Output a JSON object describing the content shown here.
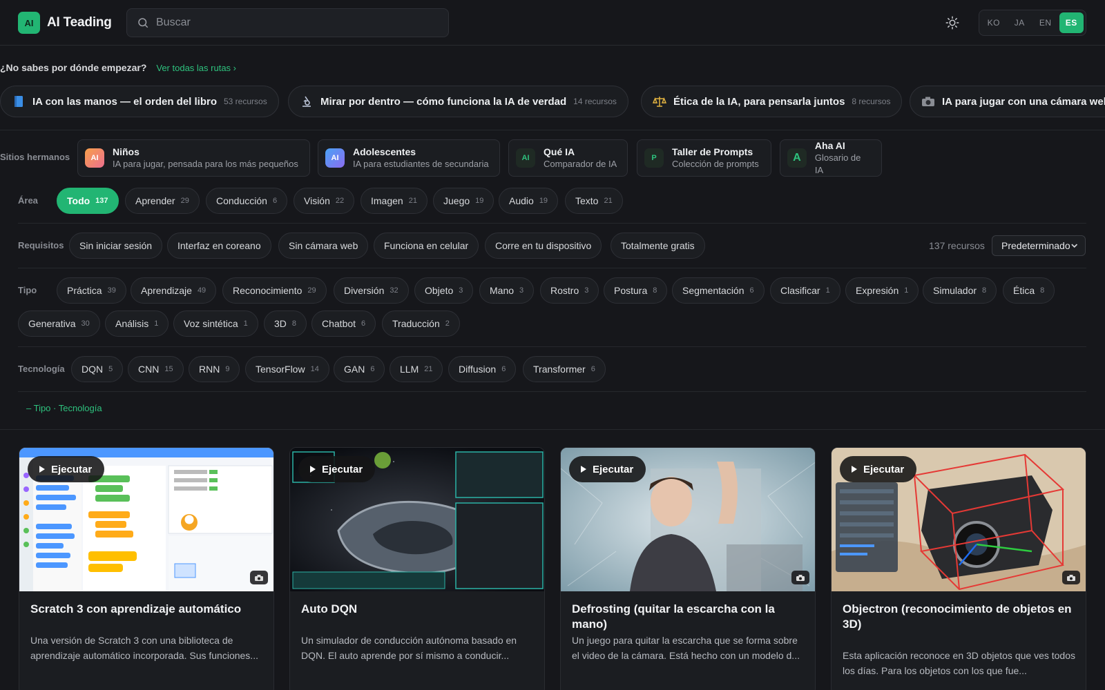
{
  "header": {
    "logo_badge": "AI",
    "brand": "AI Teading",
    "search_placeholder": "Buscar",
    "languages": [
      "KO",
      "JA",
      "EN",
      "ES"
    ],
    "active_language": "ES"
  },
  "paths": {
    "question": "¿No sabes por dónde empezar?",
    "see_all": "Ver todas las rutas ›",
    "items": [
      {
        "title": "IA con las manos — el orden del libro",
        "count": "53 recursos",
        "icon": "book-icon"
      },
      {
        "title": "Mirar por dentro — cómo funciona la IA de verdad",
        "count": "14 recursos",
        "icon": "microscope-icon"
      },
      {
        "title": "Ética de la IA, para pensarla juntos",
        "count": "8 recursos",
        "icon": "scales-icon"
      },
      {
        "title": "IA para jugar con una cámara web",
        "count": "",
        "icon": "camera-icon"
      }
    ]
  },
  "sister_sites": {
    "label": "Sitios hermanos",
    "items": [
      {
        "icon_text": "AI",
        "title": "Niños",
        "subtitle": "IA para jugar, pensada para los más pequeños",
        "color": "#f28b45"
      },
      {
        "icon_text": "AI",
        "title": "Adolescentes",
        "subtitle": "IA para estudiantes de secundaria",
        "color": "#5b8df5"
      },
      {
        "icon_text": "AI",
        "title": "Qué IA",
        "subtitle": "Comparador de IA",
        "color": "#1f2a24"
      },
      {
        "icon_text": "P",
        "title": "Taller de Prompts",
        "subtitle": "Colección de prompts",
        "color": "#1f2a24"
      },
      {
        "icon_text": "A",
        "title": "Aha AI",
        "subtitle": "Glosario de IA",
        "color": "#1f2a24"
      }
    ]
  },
  "filters": {
    "area_label": "Área",
    "area": [
      {
        "label": "Todo",
        "count": "137",
        "active": true
      },
      {
        "label": "Aprender",
        "count": "29"
      },
      {
        "label": "Conducción",
        "count": "6"
      },
      {
        "label": "Visión",
        "count": "22"
      },
      {
        "label": "Imagen",
        "count": "21"
      },
      {
        "label": "Juego",
        "count": "19"
      },
      {
        "label": "Audio",
        "count": "19"
      },
      {
        "label": "Texto",
        "count": "21"
      }
    ],
    "req_label": "Requisitos",
    "requirements": [
      "Sin iniciar sesión",
      "Interfaz en coreano",
      "Sin cámara web",
      "Funciona en celular",
      "Corre en tu dispositivo",
      "Totalmente gratis"
    ],
    "result_count": "137 recursos",
    "sort_value": "Predeterminado",
    "type_label": "Tipo",
    "types": [
      {
        "label": "Práctica",
        "count": "39"
      },
      {
        "label": "Aprendizaje",
        "count": "49"
      },
      {
        "label": "Reconocimiento",
        "count": "29"
      },
      {
        "label": "Diversión",
        "count": "32"
      },
      {
        "label": "Objeto",
        "count": "3"
      },
      {
        "label": "Mano",
        "count": "3"
      },
      {
        "label": "Rostro",
        "count": "3"
      },
      {
        "label": "Postura",
        "count": "8"
      },
      {
        "label": "Segmentación",
        "count": "6"
      },
      {
        "label": "Clasificar",
        "count": "1"
      },
      {
        "label": "Expresión",
        "count": "1"
      },
      {
        "label": "Simulador",
        "count": "8"
      },
      {
        "label": "Ética",
        "count": "8"
      },
      {
        "label": "Generativa",
        "count": "30"
      },
      {
        "label": "Análisis",
        "count": "1"
      },
      {
        "label": "Voz sintética",
        "count": "1"
      },
      {
        "label": "3D",
        "count": "8"
      },
      {
        "label": "Chatbot",
        "count": "6"
      },
      {
        "label": "Traducción",
        "count": "2"
      }
    ],
    "tech_label": "Tecnología",
    "tech": [
      {
        "label": "DQN",
        "count": "5"
      },
      {
        "label": "CNN",
        "count": "15"
      },
      {
        "label": "RNN",
        "count": "9"
      },
      {
        "label": "TensorFlow",
        "count": "14"
      },
      {
        "label": "GAN",
        "count": "6"
      },
      {
        "label": "LLM",
        "count": "21"
      },
      {
        "label": "Diffusion",
        "count": "6"
      },
      {
        "label": "Transformer",
        "count": "6"
      }
    ],
    "collapse": "– Tipo · Tecnología"
  },
  "cards": [
    {
      "run": "Ejecutar",
      "title": "Scratch 3 con aprendizaje automático",
      "desc": "Una versión de Scratch 3 con una biblioteca de aprendizaje automático incorporada. Sus funciones..."
    },
    {
      "run": "Ejecutar",
      "title": "Auto DQN",
      "desc": "Un simulador de conducción autónoma basado en DQN. El auto aprende por sí mismo a conducir..."
    },
    {
      "run": "Ejecutar",
      "title": "Defrosting (quitar la escarcha con la mano)",
      "desc": "Un juego para quitar la escarcha que se forma sobre el video de la cámara. Está hecho con un modelo d..."
    },
    {
      "run": "Ejecutar",
      "title": "Objectron (reconocimiento de objetos en 3D)",
      "desc": "Esta aplicación reconoce en 3D objetos que ves todos los días. Para los objetos con los que fue..."
    }
  ],
  "colors": {
    "accent": "#22b573",
    "background": "#16171b",
    "surface": "#1b1d21"
  }
}
